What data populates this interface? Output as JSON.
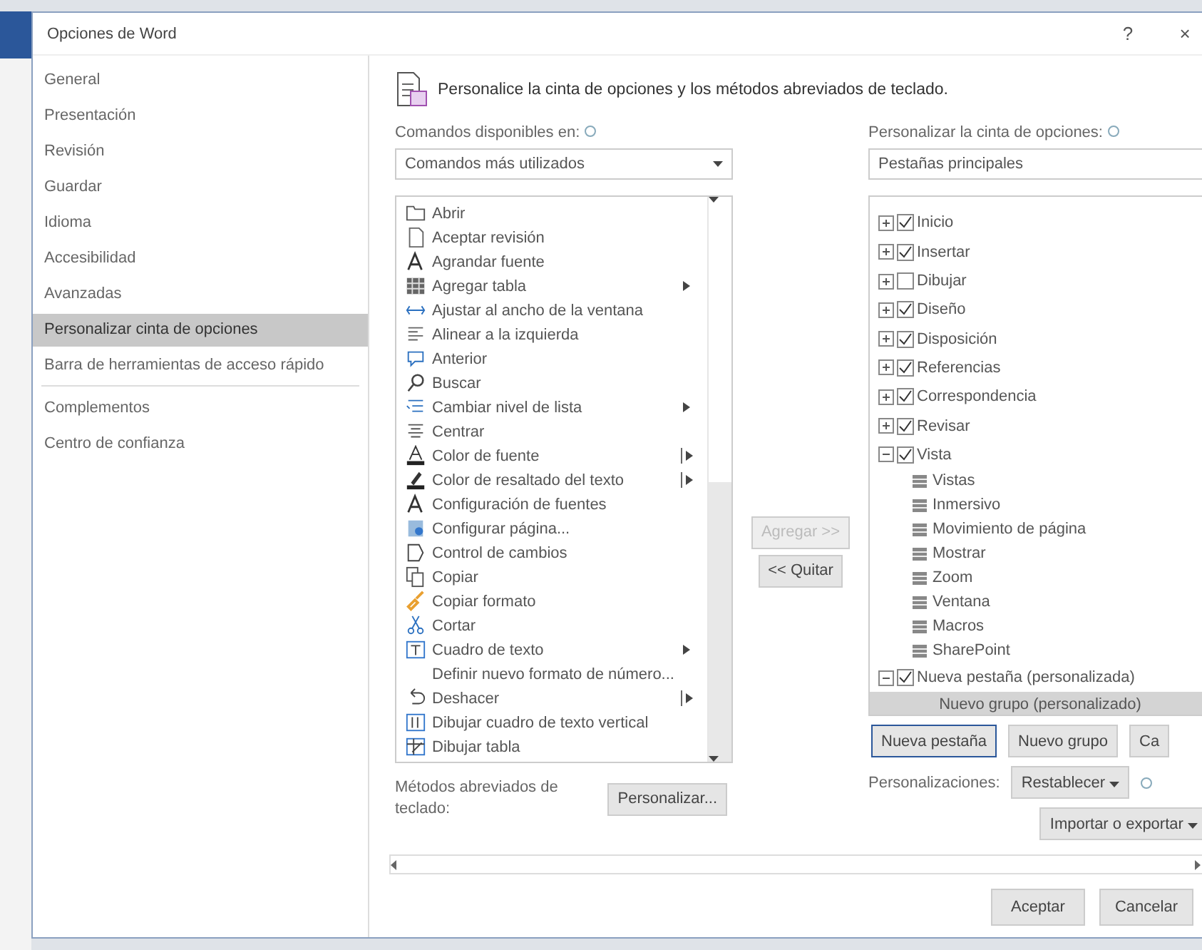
{
  "window": {
    "title": "Opciones de Word",
    "help": "?",
    "close": "×"
  },
  "sidebar": {
    "items": [
      {
        "label": "General",
        "selected": false
      },
      {
        "label": "Presentación",
        "selected": false
      },
      {
        "label": "Revisión",
        "selected": false
      },
      {
        "label": "Guardar",
        "selected": false
      },
      {
        "label": "Idioma",
        "selected": false
      },
      {
        "label": "Accesibilidad",
        "selected": false
      },
      {
        "label": "Avanzadas",
        "selected": false
      },
      {
        "label": "Personalizar cinta de opciones",
        "selected": true
      },
      {
        "label": "Barra de herramientas de acceso rápido",
        "selected": false
      },
      {
        "label": "Complementos",
        "selected": false,
        "divider_before": true
      },
      {
        "label": "Centro de confianza",
        "selected": false
      }
    ]
  },
  "header": "Personalice la cinta de opciones y los métodos abreviados de teclado.",
  "commands_label": "Comandos disponibles en:",
  "commands_source": "Comandos más utilizados",
  "ribbon_label": "Personalizar la cinta de opciones:",
  "ribbon_source": "Pestañas principales",
  "commands": [
    {
      "label": "Abrir",
      "kind": "plain",
      "selected": false
    },
    {
      "label": "Aceptar revisión",
      "kind": "plain",
      "selected": false
    },
    {
      "label": "Agrandar fuente",
      "kind": "plain",
      "selected": false
    },
    {
      "label": "Agregar tabla",
      "kind": "submenu",
      "selected": false
    },
    {
      "label": "Ajustar al ancho de la ventana",
      "kind": "plain",
      "selected": false
    },
    {
      "label": "Alinear a la izquierda",
      "kind": "plain",
      "selected": false
    },
    {
      "label": "Anterior",
      "kind": "plain",
      "selected": false
    },
    {
      "label": "Buscar",
      "kind": "plain",
      "selected": false
    },
    {
      "label": "Cambiar nivel de lista",
      "kind": "submenu",
      "selected": false
    },
    {
      "label": "Centrar",
      "kind": "plain",
      "selected": false
    },
    {
      "label": "Color de fuente",
      "kind": "split",
      "selected": false
    },
    {
      "label": "Color de resaltado del texto",
      "kind": "split",
      "selected": false
    },
    {
      "label": "Configuración de fuentes",
      "kind": "plain",
      "selected": false
    },
    {
      "label": "Configurar página...",
      "kind": "plain",
      "selected": false
    },
    {
      "label": "Control de cambios",
      "kind": "plain",
      "selected": false
    },
    {
      "label": "Copiar",
      "kind": "plain",
      "selected": false
    },
    {
      "label": "Copiar formato",
      "kind": "plain",
      "selected": false
    },
    {
      "label": "Cortar",
      "kind": "plain",
      "selected": false
    },
    {
      "label": "Cuadro de texto",
      "kind": "submenu",
      "selected": false
    },
    {
      "label": "Definir nuevo formato de número...",
      "kind": "plain",
      "selected": false
    },
    {
      "label": "Deshacer",
      "kind": "split",
      "selected": false
    },
    {
      "label": "Dibujar cuadro de texto vertical",
      "kind": "plain",
      "selected": false
    },
    {
      "label": "Dibujar tabla",
      "kind": "plain",
      "selected": false
    }
  ],
  "add_button": {
    "label": "Agregar >>",
    "disabled": true
  },
  "remove_button": {
    "label": "<< Quitar",
    "disabled": false
  },
  "tabs_tree": [
    {
      "label": "Inicio",
      "checked": true,
      "expanded": false,
      "selected": false
    },
    {
      "label": "Insertar",
      "checked": true,
      "expanded": false,
      "selected": false
    },
    {
      "label": "Dibujar",
      "checked": false,
      "expanded": false,
      "selected": false
    },
    {
      "label": "Diseño",
      "checked": true,
      "expanded": false,
      "selected": false
    },
    {
      "label": "Disposición",
      "checked": true,
      "expanded": false,
      "selected": false
    },
    {
      "label": "Referencias",
      "checked": true,
      "expanded": false,
      "selected": false
    },
    {
      "label": "Correspondencia",
      "checked": true,
      "expanded": false,
      "selected": false
    },
    {
      "label": "Revisar",
      "checked": true,
      "expanded": false,
      "selected": false
    },
    {
      "label": "Vista",
      "checked": true,
      "expanded": true,
      "selected": false,
      "children": [
        {
          "label": "Vistas",
          "selected": false
        },
        {
          "label": "Inmersivo",
          "selected": false
        },
        {
          "label": "Movimiento de página",
          "selected": false
        },
        {
          "label": "Mostrar",
          "selected": false
        },
        {
          "label": "Zoom",
          "selected": false
        },
        {
          "label": "Ventana",
          "selected": false
        },
        {
          "label": "Macros",
          "selected": false
        },
        {
          "label": "SharePoint",
          "selected": false
        }
      ]
    },
    {
      "label": "Nueva pestaña (personalizada)",
      "checked": true,
      "expanded": true,
      "selected": false,
      "children": [
        {
          "label": "Nuevo grupo (personalizado)",
          "selected": true
        }
      ]
    }
  ],
  "tree_buttons": [
    {
      "label": "Nueva pestaña",
      "focused": true
    },
    {
      "label": "Nuevo grupo",
      "focused": false
    },
    {
      "label": "Ca",
      "focused": false
    }
  ],
  "customizations_label": "Personalizaciones:",
  "reset_button": "Restablecer",
  "import_export_button": "Importar o exportar",
  "shortcuts_label": "Métodos abreviados de teclado:",
  "shortcuts_button": "Personalizar...",
  "footer": {
    "ok": "Aceptar",
    "cancel": "Cancelar"
  }
}
